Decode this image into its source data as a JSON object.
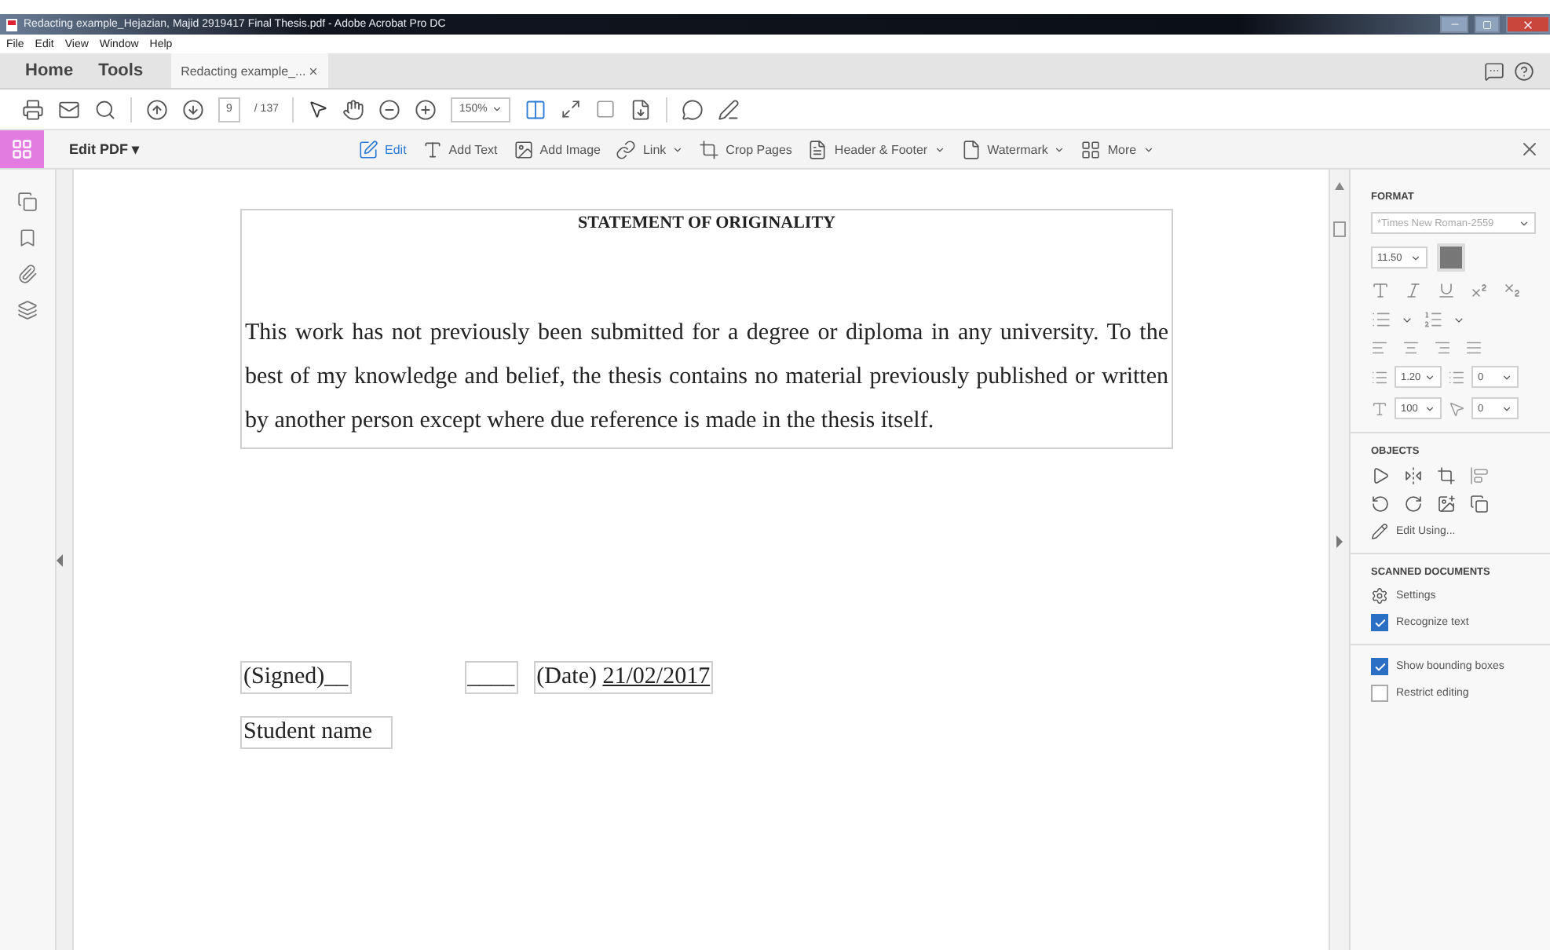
{
  "window": {
    "title": "Redacting example_Hejazian, Majid 2919417 Final Thesis.pdf - Adobe Acrobat Pro DC"
  },
  "menu": [
    "File",
    "Edit",
    "View",
    "Window",
    "Help"
  ],
  "tabs": [
    {
      "label": "Home",
      "selected": false,
      "kind": "nav"
    },
    {
      "label": "Tools",
      "selected": false,
      "kind": "nav"
    },
    {
      "label": "Redacting example_...",
      "selected": true,
      "kind": "document"
    }
  ],
  "toolbar": {
    "page": "9",
    "page_total": "/ 137",
    "zoom": "150%"
  },
  "edit_bar": {
    "title": "Edit PDF ▾",
    "tools": [
      {
        "label": "Edit",
        "selected": true,
        "dropdown": false
      },
      {
        "label": "Add Text",
        "selected": false,
        "dropdown": false
      },
      {
        "label": "Add Image",
        "selected": false,
        "dropdown": false
      },
      {
        "label": "Link",
        "selected": false,
        "dropdown": true
      },
      {
        "label": "Crop Pages",
        "selected": false,
        "dropdown": false
      },
      {
        "label": "Header & Footer",
        "selected": false,
        "dropdown": true
      },
      {
        "label": "Watermark",
        "selected": false,
        "dropdown": true
      },
      {
        "label": "More",
        "selected": false,
        "dropdown": true
      }
    ]
  },
  "document": {
    "heading": "STATEMENT OF ORIGINALITY",
    "paragraph": "This work has not previously been submitted for a degree or diploma in any university. To the best of my knowledge and belief, the thesis contains no material previously published or written by another person except where due reference is made in the thesis itself.",
    "signature_fields": [
      {
        "label": "(Signed)__"
      },
      {
        "label": "____"
      },
      {
        "label": "(Date)",
        "value": "21/02/2017"
      }
    ],
    "name_field": "Student name"
  },
  "format_panel": {
    "heading": "FORMAT",
    "font": "*Times New Roman-2559",
    "size": "11.50",
    "line_spacing": "1.20",
    "paragraph_spacing": "0",
    "scale": "100",
    "tracking": "0"
  },
  "objects_panel": {
    "heading": "OBJECTS",
    "edit_using": "Edit Using..."
  },
  "scanned_panel": {
    "heading": "SCANNED DOCUMENTS",
    "settings": "Settings",
    "options": [
      {
        "label": "Recognize text",
        "checked": true
      }
    ]
  },
  "options": [
    {
      "label": "Show bounding boxes",
      "checked": true
    },
    {
      "label": "Restrict editing",
      "checked": false
    }
  ]
}
